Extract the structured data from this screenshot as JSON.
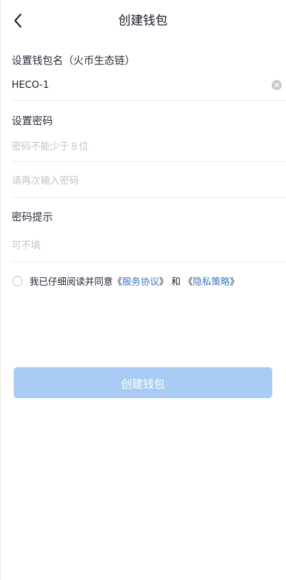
{
  "navbar": {
    "title": "创建钱包",
    "back_icon": "chevron-left-icon"
  },
  "wallet_name": {
    "label": "设置钱包名（火币生态链）",
    "value": "HECO-1",
    "clear_icon": "clear-circle-icon"
  },
  "password": {
    "label": "设置密码",
    "placeholder": "密码不能少于８位",
    "confirm_placeholder": "请再次输入密码"
  },
  "hint": {
    "label": "密码提示",
    "placeholder": "可不填"
  },
  "agreement": {
    "prefix": "我已仔细阅读并同意",
    "open1": " 《",
    "terms": "服务协议",
    "close1": "》",
    "and": " 和 ",
    "open2": "《",
    "privacy": "隐私策略",
    "close2": "》",
    "link_color": "#3a78c4"
  },
  "submit": {
    "label": "创建钱包",
    "color": "#a8ccf4"
  }
}
